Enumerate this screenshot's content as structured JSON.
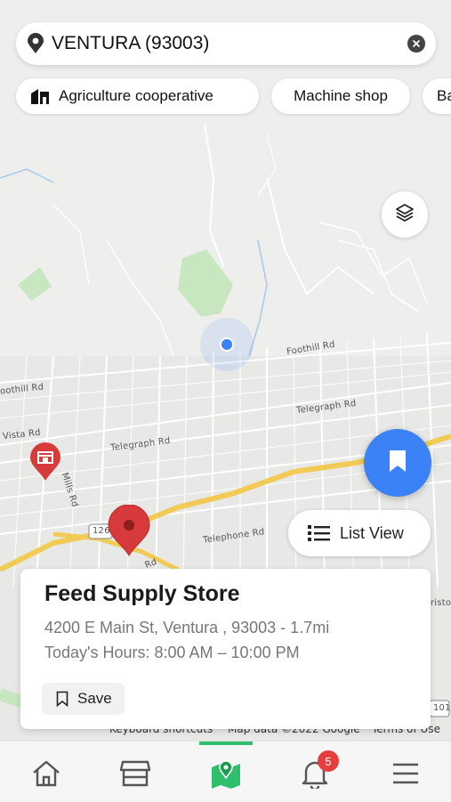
{
  "search": {
    "value": "VENTURA (93003)",
    "icon": "location-pin-icon"
  },
  "chips": [
    {
      "label": "Agriculture cooperative",
      "icon": "agriculture-icon"
    },
    {
      "label": "Machine shop"
    },
    {
      "label": "Ba"
    }
  ],
  "map": {
    "road_labels": [
      "Foothill Rd",
      "oothill Rd",
      "Telegraph Rd",
      "Telegraph Rd",
      "Vista Rd",
      "Mills Rd",
      "Telephone Rd",
      "Rd",
      "126",
      "risto",
      "101"
    ],
    "attribution": {
      "keyboard": "Keyboard shortcuts",
      "data": "Map data ©2022 Google",
      "terms": "Terms of Use"
    }
  },
  "list_view": {
    "label": "List View"
  },
  "card": {
    "name": "Feed Supply Store",
    "address": "4200 E Main St, Ventura , 93003 - 1.7mi",
    "hours": "Today's Hours: 8:00 AM – 10:00 PM",
    "save_label": "Save"
  },
  "nav": {
    "items": [
      "home",
      "store",
      "map",
      "notifications",
      "menu"
    ],
    "active": "map",
    "notification_count": "5"
  },
  "colors": {
    "accent_blue": "#3b82f6",
    "nav_active_green": "#2fbf6c",
    "marker_red": "#d63a3a",
    "badge_red": "#e53e3e"
  }
}
